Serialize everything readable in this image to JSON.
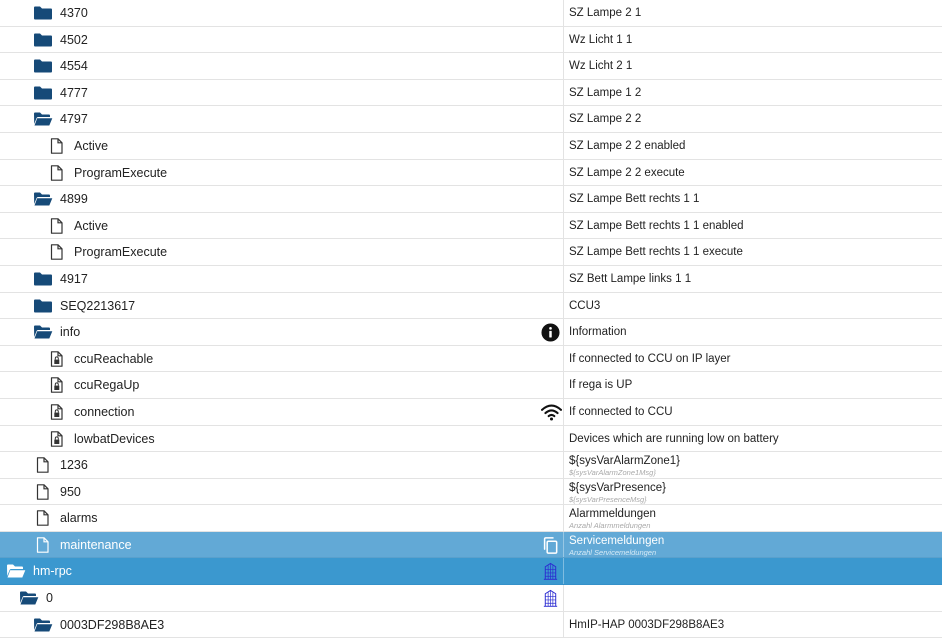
{
  "rows": [
    {
      "name": "4370",
      "icon": "folder-closed",
      "desc": "SZ Lampe 2 1"
    },
    {
      "name": "4502",
      "icon": "folder-closed",
      "desc": "Wz Licht 1 1"
    },
    {
      "name": "4554",
      "icon": "folder-closed",
      "desc": "Wz Licht 2 1"
    },
    {
      "name": "4777",
      "icon": "folder-closed",
      "desc": "SZ Lampe 1 2"
    },
    {
      "name": "4797",
      "icon": "folder-open",
      "desc": "SZ Lampe 2 2"
    },
    {
      "name": "Active",
      "icon": "file",
      "desc": "SZ Lampe 2 2 enabled"
    },
    {
      "name": "ProgramExecute",
      "icon": "file",
      "desc": "SZ Lampe 2 2 execute"
    },
    {
      "name": "4899",
      "icon": "folder-open",
      "desc": "SZ Lampe Bett rechts 1 1"
    },
    {
      "name": "Active",
      "icon": "file",
      "desc": "SZ Lampe Bett rechts 1 1 enabled"
    },
    {
      "name": "ProgramExecute",
      "icon": "file",
      "desc": "SZ Lampe Bett rechts 1 1 execute"
    },
    {
      "name": "4917",
      "icon": "folder-closed",
      "desc": "SZ Bett Lampe links 1 1"
    },
    {
      "name": "SEQ2213617",
      "icon": "folder-closed",
      "desc": "CCU3"
    },
    {
      "name": "info",
      "icon": "folder-open",
      "desc": "Information",
      "right_icon": "info-icon"
    },
    {
      "name": "ccuReachable",
      "icon": "file-locked",
      "desc": "If connected to CCU on IP layer"
    },
    {
      "name": "ccuRegaUp",
      "icon": "file-locked",
      "desc": "If rega is UP"
    },
    {
      "name": "connection",
      "icon": "file-locked",
      "desc": "If connected to CCU",
      "right_icon": "wifi-icon"
    },
    {
      "name": "lowbatDevices",
      "icon": "file-locked",
      "desc": "Devices which are running low on battery"
    },
    {
      "name": "1236",
      "icon": "file",
      "desc": "${sysVarAlarmZone1}",
      "sub": "${sysVarAlarmZone1Msg}"
    },
    {
      "name": "950",
      "icon": "file",
      "desc": "${sysVarPresence}",
      "sub": "${sysVarPresenceMsg}"
    },
    {
      "name": "alarms",
      "icon": "file",
      "desc": "Alarmmeldungen",
      "sub": "Anzahl Alarmmeldungen"
    },
    {
      "name": "maintenance",
      "icon": "file",
      "desc": "Servicemeldungen",
      "sub": "Anzahl Servicemeldungen",
      "right_icon": "copy-icon",
      "highlight": "light"
    },
    {
      "name": "hm-rpc",
      "icon": "folder-open",
      "desc": "",
      "right_icon": "instance-icon",
      "highlight": "dark"
    },
    {
      "name": "0",
      "icon": "folder-open",
      "desc": "",
      "right_icon": "instance-icon"
    },
    {
      "name": "0003DF298B8AE3",
      "icon": "folder-open",
      "desc": "HmIP-HAP 0003DF298B8AE3"
    }
  ],
  "colors": {
    "folder": "#164a78",
    "file": "#333333",
    "highlight_light": "#62a9d6",
    "highlight_dark": "#3b98cf"
  }
}
